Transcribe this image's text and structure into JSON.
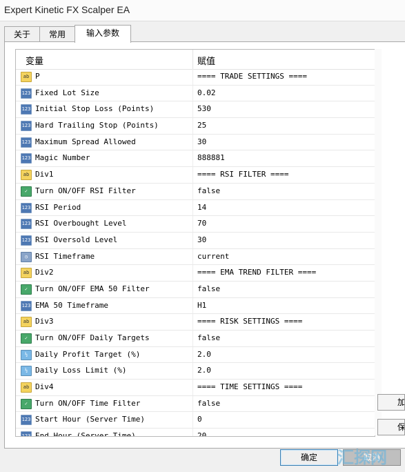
{
  "window": {
    "title": "Expert Kinetic FX Scalper EA"
  },
  "tabs": [
    {
      "label": "关于"
    },
    {
      "label": "常用"
    },
    {
      "label": "输入参数"
    }
  ],
  "grid": {
    "header_variable": "变量",
    "header_value": "赋值",
    "rows": [
      {
        "icon": "ab",
        "name": "P",
        "value": "==== TRADE SETTINGS ===="
      },
      {
        "icon": "123",
        "name": "Fixed Lot Size",
        "value": "0.02"
      },
      {
        "icon": "123",
        "name": "Initial Stop Loss (Points)",
        "value": "530"
      },
      {
        "icon": "123",
        "name": "Hard Trailing Stop (Points)",
        "value": "25"
      },
      {
        "icon": "123",
        "name": "Maximum Spread Allowed",
        "value": "30"
      },
      {
        "icon": "123",
        "name": "Magic Number",
        "value": "888881"
      },
      {
        "icon": "ab",
        "name": "Div1",
        "value": "==== RSI FILTER ===="
      },
      {
        "icon": "bool",
        "name": "Turn ON/OFF RSI Filter",
        "value": "false"
      },
      {
        "icon": "123",
        "name": "RSI Period",
        "value": "14"
      },
      {
        "icon": "123",
        "name": "RSI Overbought Level",
        "value": "70"
      },
      {
        "icon": "123",
        "name": "RSI Oversold Level",
        "value": "30"
      },
      {
        "icon": "tf",
        "name": "RSI Timeframe",
        "value": "current"
      },
      {
        "icon": "ab",
        "name": "Div2",
        "value": "==== EMA TREND FILTER ===="
      },
      {
        "icon": "bool",
        "name": "Turn ON/OFF EMA 50 Filter",
        "value": "false"
      },
      {
        "icon": "123",
        "name": "EMA 50 Timeframe",
        "value": "H1"
      },
      {
        "icon": "ab",
        "name": "Div3",
        "value": "==== RISK SETTINGS ===="
      },
      {
        "icon": "bool",
        "name": "Turn ON/OFF Daily Targets",
        "value": "false"
      },
      {
        "icon": "dbl",
        "name": "Daily Profit Target (%)",
        "value": "2.0"
      },
      {
        "icon": "dbl",
        "name": "Daily Loss Limit (%)",
        "value": "2.0"
      },
      {
        "icon": "ab",
        "name": "Div4",
        "value": "==== TIME SETTINGS ===="
      },
      {
        "icon": "bool",
        "name": "Turn ON/OFF Time Filter",
        "value": "false"
      },
      {
        "icon": "123",
        "name": "Start Hour (Server Time)",
        "value": "0"
      },
      {
        "icon": "123",
        "name": "End Hour (Server Time)",
        "value": "20"
      }
    ]
  },
  "side": {
    "load_label": "加载",
    "save_label": "保存"
  },
  "footer": {
    "ok_label": "确定",
    "cancel_label": "取消"
  },
  "watermark": "汇探网"
}
